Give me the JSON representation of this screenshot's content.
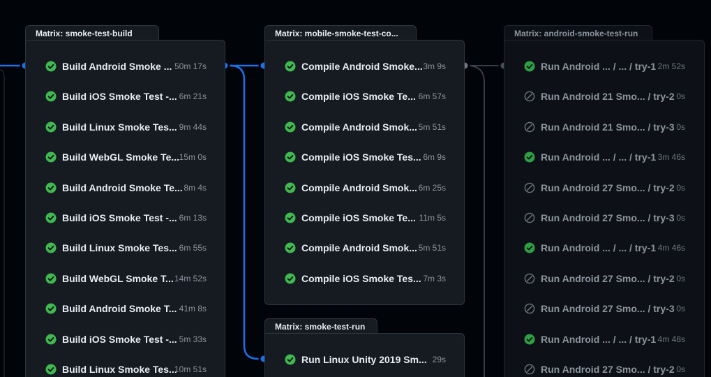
{
  "colors": {
    "success": "#3fb950",
    "connector": "#1f6feb",
    "connector_muted": "#484f58",
    "skipped": "#6e7681"
  },
  "groups": [
    {
      "title": "Matrix: smoke-test-build",
      "jobs": [
        {
          "name": "Build Android Smoke ...",
          "duration": "50m 17s",
          "status": "success",
          "icon": "check-circle-icon"
        },
        {
          "name": "Build iOS Smoke Test -...",
          "duration": "6m 21s",
          "status": "success",
          "icon": "check-circle-icon"
        },
        {
          "name": "Build Linux Smoke Tes...",
          "duration": "9m 44s",
          "status": "success",
          "icon": "check-circle-icon"
        },
        {
          "name": "Build WebGL Smoke Te...",
          "duration": "15m 0s",
          "status": "success",
          "icon": "check-circle-icon"
        },
        {
          "name": "Build Android Smoke Te...",
          "duration": "8m 4s",
          "status": "success",
          "icon": "check-circle-icon"
        },
        {
          "name": "Build iOS Smoke Test -...",
          "duration": "6m 13s",
          "status": "success",
          "icon": "check-circle-icon"
        },
        {
          "name": "Build Linux Smoke Tes...",
          "duration": "6m 55s",
          "status": "success",
          "icon": "check-circle-icon"
        },
        {
          "name": "Build WebGL Smoke T...",
          "duration": "14m 52s",
          "status": "success",
          "icon": "check-circle-icon"
        },
        {
          "name": "Build Android Smoke T...",
          "duration": "41m 8s",
          "status": "success",
          "icon": "check-circle-icon"
        },
        {
          "name": "Build iOS Smoke Test -...",
          "duration": "5m 33s",
          "status": "success",
          "icon": "check-circle-icon"
        },
        {
          "name": "Build Linux Smoke Tes...",
          "duration": "10m 51s",
          "status": "success",
          "icon": "check-circle-icon"
        }
      ]
    },
    {
      "title": "Matrix: mobile-smoke-test-co...",
      "jobs": [
        {
          "name": "Compile Android Smoke...",
          "duration": "3m 9s",
          "status": "success",
          "icon": "check-circle-icon"
        },
        {
          "name": "Compile iOS Smoke Te...",
          "duration": "6m 57s",
          "status": "success",
          "icon": "check-circle-icon"
        },
        {
          "name": "Compile Android Smok...",
          "duration": "5m 51s",
          "status": "success",
          "icon": "check-circle-icon"
        },
        {
          "name": "Compile iOS Smoke Tes...",
          "duration": "6m 9s",
          "status": "success",
          "icon": "check-circle-icon"
        },
        {
          "name": "Compile Android Smok...",
          "duration": "6m 25s",
          "status": "success",
          "icon": "check-circle-icon"
        },
        {
          "name": "Compile iOS Smoke Te...",
          "duration": "11m 5s",
          "status": "success",
          "icon": "check-circle-icon"
        },
        {
          "name": "Compile Android Smok...",
          "duration": "5m 51s",
          "status": "success",
          "icon": "check-circle-icon"
        },
        {
          "name": "Compile iOS Smoke Tes...",
          "duration": "7m 3s",
          "status": "success",
          "icon": "check-circle-icon"
        }
      ]
    },
    {
      "title": "Matrix: smoke-test-run",
      "jobs": [
        {
          "name": "Run Linux Unity 2019 Sm...",
          "duration": "29s",
          "status": "success",
          "icon": "check-circle-icon"
        }
      ]
    },
    {
      "title": "Matrix: android-smoke-test-run",
      "jobs": [
        {
          "name": "Run Android ... / ... / try-1",
          "duration": "2m 52s",
          "status": "success",
          "icon": "check-circle-icon"
        },
        {
          "name": "Run Android 21 Smo... / try-2",
          "duration": "0s",
          "status": "skipped",
          "icon": "skip-icon"
        },
        {
          "name": "Run Android 21 Smo... / try-3",
          "duration": "0s",
          "status": "skipped",
          "icon": "skip-icon"
        },
        {
          "name": "Run Android ... / ... / try-1",
          "duration": "3m 46s",
          "status": "success",
          "icon": "check-circle-icon"
        },
        {
          "name": "Run Android 27 Smo... / try-2",
          "duration": "0s",
          "status": "skipped",
          "icon": "skip-icon"
        },
        {
          "name": "Run Android 27 Smo... / try-3",
          "duration": "0s",
          "status": "skipped",
          "icon": "skip-icon"
        },
        {
          "name": "Run Android ... / ... / try-1",
          "duration": "4m 46s",
          "status": "success",
          "icon": "check-circle-icon"
        },
        {
          "name": "Run Android 27 Smo... / try-2",
          "duration": "0s",
          "status": "skipped",
          "icon": "skip-icon"
        },
        {
          "name": "Run Android 27 Smo... / try-3",
          "duration": "0s",
          "status": "skipped",
          "icon": "skip-icon"
        },
        {
          "name": "Run Android ... / ... / try-1",
          "duration": "4m 48s",
          "status": "success",
          "icon": "check-circle-icon"
        },
        {
          "name": "Run Android 27 Smo... / try-2",
          "duration": "0s",
          "status": "skipped",
          "icon": "skip-icon"
        }
      ]
    }
  ]
}
